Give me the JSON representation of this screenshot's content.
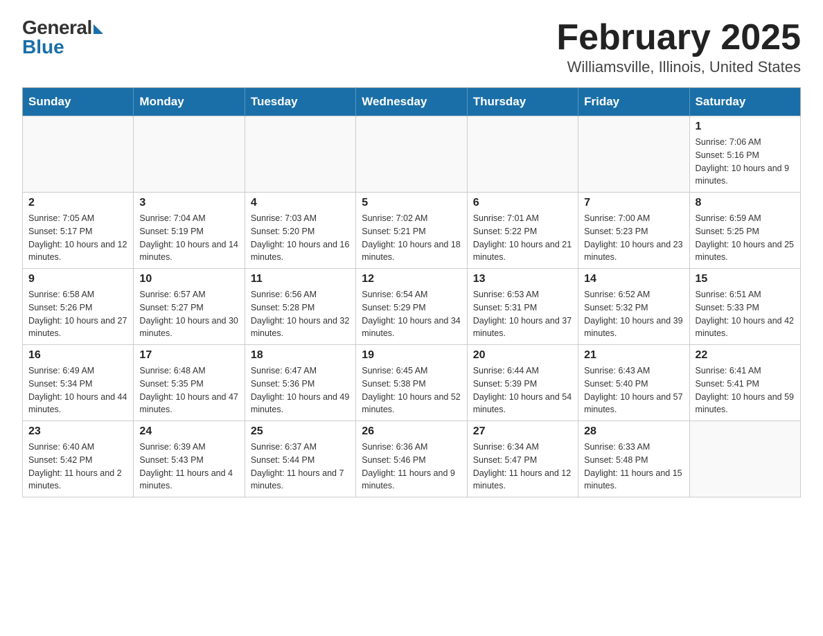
{
  "header": {
    "logo_general": "General",
    "logo_blue": "Blue",
    "title": "February 2025",
    "subtitle": "Williamsville, Illinois, United States"
  },
  "days_of_week": [
    "Sunday",
    "Monday",
    "Tuesday",
    "Wednesday",
    "Thursday",
    "Friday",
    "Saturday"
  ],
  "weeks": [
    [
      {
        "day": "",
        "info": ""
      },
      {
        "day": "",
        "info": ""
      },
      {
        "day": "",
        "info": ""
      },
      {
        "day": "",
        "info": ""
      },
      {
        "day": "",
        "info": ""
      },
      {
        "day": "",
        "info": ""
      },
      {
        "day": "1",
        "info": "Sunrise: 7:06 AM\nSunset: 5:16 PM\nDaylight: 10 hours and 9 minutes."
      }
    ],
    [
      {
        "day": "2",
        "info": "Sunrise: 7:05 AM\nSunset: 5:17 PM\nDaylight: 10 hours and 12 minutes."
      },
      {
        "day": "3",
        "info": "Sunrise: 7:04 AM\nSunset: 5:19 PM\nDaylight: 10 hours and 14 minutes."
      },
      {
        "day": "4",
        "info": "Sunrise: 7:03 AM\nSunset: 5:20 PM\nDaylight: 10 hours and 16 minutes."
      },
      {
        "day": "5",
        "info": "Sunrise: 7:02 AM\nSunset: 5:21 PM\nDaylight: 10 hours and 18 minutes."
      },
      {
        "day": "6",
        "info": "Sunrise: 7:01 AM\nSunset: 5:22 PM\nDaylight: 10 hours and 21 minutes."
      },
      {
        "day": "7",
        "info": "Sunrise: 7:00 AM\nSunset: 5:23 PM\nDaylight: 10 hours and 23 minutes."
      },
      {
        "day": "8",
        "info": "Sunrise: 6:59 AM\nSunset: 5:25 PM\nDaylight: 10 hours and 25 minutes."
      }
    ],
    [
      {
        "day": "9",
        "info": "Sunrise: 6:58 AM\nSunset: 5:26 PM\nDaylight: 10 hours and 27 minutes."
      },
      {
        "day": "10",
        "info": "Sunrise: 6:57 AM\nSunset: 5:27 PM\nDaylight: 10 hours and 30 minutes."
      },
      {
        "day": "11",
        "info": "Sunrise: 6:56 AM\nSunset: 5:28 PM\nDaylight: 10 hours and 32 minutes."
      },
      {
        "day": "12",
        "info": "Sunrise: 6:54 AM\nSunset: 5:29 PM\nDaylight: 10 hours and 34 minutes."
      },
      {
        "day": "13",
        "info": "Sunrise: 6:53 AM\nSunset: 5:31 PM\nDaylight: 10 hours and 37 minutes."
      },
      {
        "day": "14",
        "info": "Sunrise: 6:52 AM\nSunset: 5:32 PM\nDaylight: 10 hours and 39 minutes."
      },
      {
        "day": "15",
        "info": "Sunrise: 6:51 AM\nSunset: 5:33 PM\nDaylight: 10 hours and 42 minutes."
      }
    ],
    [
      {
        "day": "16",
        "info": "Sunrise: 6:49 AM\nSunset: 5:34 PM\nDaylight: 10 hours and 44 minutes."
      },
      {
        "day": "17",
        "info": "Sunrise: 6:48 AM\nSunset: 5:35 PM\nDaylight: 10 hours and 47 minutes."
      },
      {
        "day": "18",
        "info": "Sunrise: 6:47 AM\nSunset: 5:36 PM\nDaylight: 10 hours and 49 minutes."
      },
      {
        "day": "19",
        "info": "Sunrise: 6:45 AM\nSunset: 5:38 PM\nDaylight: 10 hours and 52 minutes."
      },
      {
        "day": "20",
        "info": "Sunrise: 6:44 AM\nSunset: 5:39 PM\nDaylight: 10 hours and 54 minutes."
      },
      {
        "day": "21",
        "info": "Sunrise: 6:43 AM\nSunset: 5:40 PM\nDaylight: 10 hours and 57 minutes."
      },
      {
        "day": "22",
        "info": "Sunrise: 6:41 AM\nSunset: 5:41 PM\nDaylight: 10 hours and 59 minutes."
      }
    ],
    [
      {
        "day": "23",
        "info": "Sunrise: 6:40 AM\nSunset: 5:42 PM\nDaylight: 11 hours and 2 minutes."
      },
      {
        "day": "24",
        "info": "Sunrise: 6:39 AM\nSunset: 5:43 PM\nDaylight: 11 hours and 4 minutes."
      },
      {
        "day": "25",
        "info": "Sunrise: 6:37 AM\nSunset: 5:44 PM\nDaylight: 11 hours and 7 minutes."
      },
      {
        "day": "26",
        "info": "Sunrise: 6:36 AM\nSunset: 5:46 PM\nDaylight: 11 hours and 9 minutes."
      },
      {
        "day": "27",
        "info": "Sunrise: 6:34 AM\nSunset: 5:47 PM\nDaylight: 11 hours and 12 minutes."
      },
      {
        "day": "28",
        "info": "Sunrise: 6:33 AM\nSunset: 5:48 PM\nDaylight: 11 hours and 15 minutes."
      },
      {
        "day": "",
        "info": ""
      }
    ]
  ]
}
